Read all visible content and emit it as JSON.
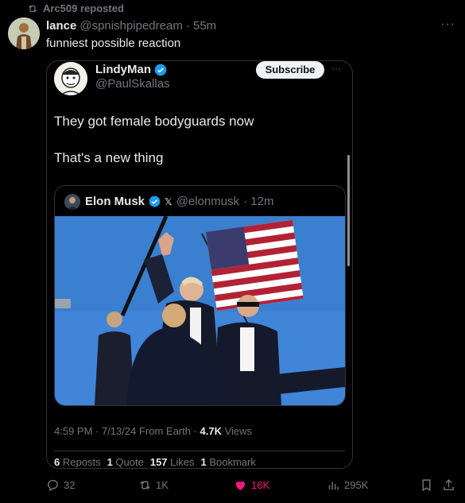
{
  "repost": {
    "text": "Arc509 reposted"
  },
  "post": {
    "author_name": "lance",
    "author_handle": "@spnishpipedream",
    "time": "· 55m",
    "text": "funniest possible reaction",
    "more": "···"
  },
  "quoted": {
    "name": "LindyMan",
    "handle": "@PaulSkallas",
    "subscribe_label": "Subscribe",
    "more": "···",
    "line1": "They got female bodyguards now",
    "line2": "That's a new thing",
    "inner": {
      "name": "Elon Musk",
      "x_mark": "𝕏",
      "handle": "@elonmusk",
      "time": "· 12m"
    },
    "timestamp": "4:59 PM · 7/13/24 From Earth · ",
    "views_count": "4.7K",
    "views_label": " Views",
    "stats": [
      {
        "count": "6",
        "label": "Reposts"
      },
      {
        "count": "1",
        "label": "Quote"
      },
      {
        "count": "157",
        "label": "Likes"
      },
      {
        "count": "1",
        "label": "Bookmark"
      }
    ]
  },
  "actions": {
    "replies": "32",
    "reposts": "1K",
    "likes": "16K",
    "views": "295K"
  },
  "colors": {
    "accent_blue": "#1d9bf0",
    "like_pink": "#f91880",
    "muted": "#71767b"
  }
}
